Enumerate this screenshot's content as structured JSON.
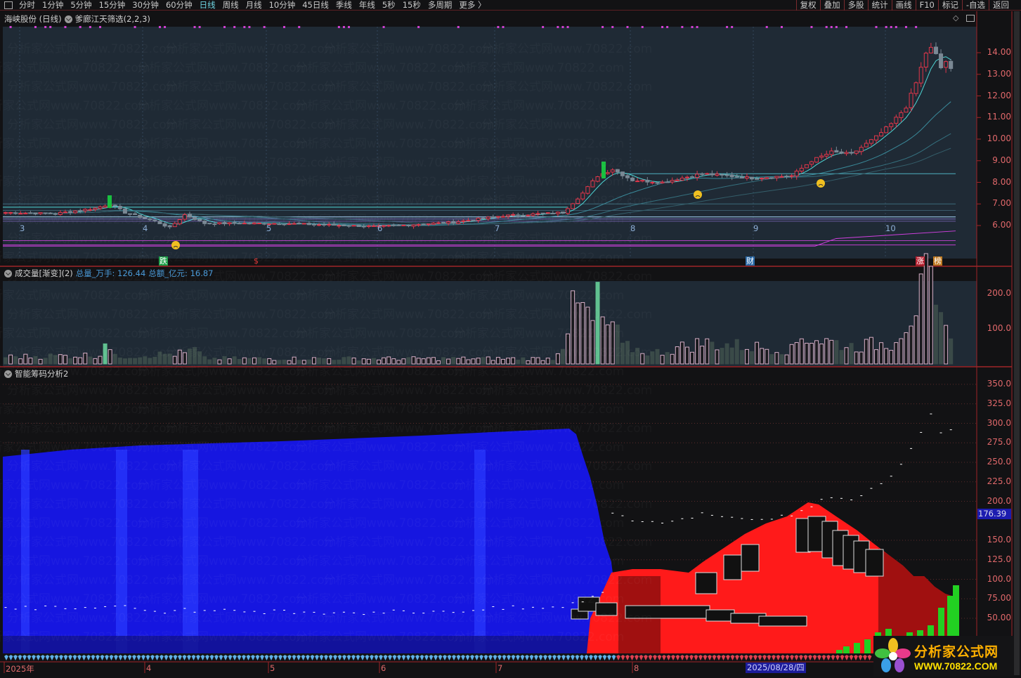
{
  "toolbar": {
    "tabs": [
      "分时",
      "1分钟",
      "5分钟",
      "15分钟",
      "30分钟",
      "60分钟",
      "日线",
      "周线",
      "月线",
      "10分钟",
      "45日线",
      "季线",
      "年线",
      "5秒",
      "15秒",
      "多周期",
      "更多 〉"
    ],
    "active_tab": "日线",
    "right_buttons": [
      "复权",
      "叠加",
      "多股",
      "统计",
      "画线",
      "F10",
      "标记",
      "-自选",
      "返回"
    ]
  },
  "price_panel": {
    "stock_title": "海峡股份 (日线)",
    "indicator": "爹廊江天筛选(2,2,3)",
    "y_ticks": [
      "14.00",
      "13.00",
      "12.00",
      "11.00",
      "10.00",
      "9.00",
      "8.00",
      "7.00",
      "6.00"
    ],
    "month_labels": [
      "3",
      "4",
      "5",
      "6",
      "7",
      "8",
      "9",
      "10"
    ],
    "event_tags": [
      {
        "text": "跌",
        "color": "#1fa04a"
      },
      {
        "text": "$",
        "color": "#e23a3a"
      },
      {
        "text": "财",
        "color": "#2a6aa8"
      },
      {
        "text": "涨",
        "color": "#b82030"
      },
      {
        "text": "榜",
        "color": "#c07a20"
      }
    ]
  },
  "volume_panel": {
    "title": "成交量[渐变](2)",
    "stat1": "总量_万手: 126.44",
    "stat2": "总额_亿元: 16.87",
    "y_ticks": [
      "200.0",
      "100.0"
    ]
  },
  "chip_panel": {
    "title": "智能筹码分析2",
    "y_ticks": [
      "350.0",
      "325.0",
      "300.0",
      "275.0",
      "250.0",
      "225.0",
      "200.0",
      "150.0",
      "125.0",
      "100.0",
      "75.00",
      "50.00"
    ],
    "current_value": "176.39"
  },
  "date_axis": {
    "labels": [
      "2025年",
      "4",
      "5",
      "6",
      "7",
      "8"
    ],
    "cursor_date": "2025/08/28/四"
  },
  "watermark": "分析家公式网www.70822.com",
  "logo": {
    "title": "分析家公式网",
    "url": "WWW.70822.COM"
  },
  "colors": {
    "up": "#e0364a",
    "down": "#7a8894",
    "ma": "#4fd6d6",
    "accent": "#6fd3e0",
    "axis": "#e0686a"
  },
  "chart_data": {
    "type": "candlestick",
    "bars": 191,
    "price_keypoints": [
      [
        0,
        6.6
      ],
      [
        10,
        6.55
      ],
      [
        18,
        6.8
      ],
      [
        21,
        7.0
      ],
      [
        24,
        6.6
      ],
      [
        30,
        6.2
      ],
      [
        33,
        5.9
      ],
      [
        36,
        6.5
      ],
      [
        40,
        6.1
      ],
      [
        55,
        6.1
      ],
      [
        75,
        5.95
      ],
      [
        90,
        6.15
      ],
      [
        100,
        6.45
      ],
      [
        112,
        6.6
      ],
      [
        116,
        7.5
      ],
      [
        119,
        8.3
      ],
      [
        122,
        8.6
      ],
      [
        126,
        8.1
      ],
      [
        132,
        8.0
      ],
      [
        140,
        8.4
      ],
      [
        150,
        8.2
      ],
      [
        158,
        8.3
      ],
      [
        162,
        9.0
      ],
      [
        166,
        9.4
      ],
      [
        170,
        9.3
      ],
      [
        175,
        10.1
      ],
      [
        178,
        10.7
      ],
      [
        181,
        11.5
      ],
      [
        183,
        12.6
      ],
      [
        185,
        14.0
      ],
      [
        186,
        14.2
      ],
      [
        187,
        13.9
      ],
      [
        188,
        13.3
      ],
      [
        189,
        13.6
      ],
      [
        190,
        13.2
      ]
    ],
    "volume_keypoints": [
      [
        0,
        20
      ],
      [
        19,
        25
      ],
      [
        20,
        80
      ],
      [
        21,
        40
      ],
      [
        22,
        20
      ],
      [
        36,
        30
      ],
      [
        38,
        40
      ],
      [
        40,
        15
      ],
      [
        110,
        15
      ],
      [
        112,
        60
      ],
      [
        114,
        150
      ],
      [
        116,
        160
      ],
      [
        118,
        110
      ],
      [
        119,
        220
      ],
      [
        120,
        100
      ],
      [
        122,
        115
      ],
      [
        124,
        50
      ],
      [
        130,
        30
      ],
      [
        140,
        60
      ],
      [
        158,
        40
      ],
      [
        160,
        80
      ],
      [
        170,
        50
      ],
      [
        178,
        60
      ],
      [
        181,
        120
      ],
      [
        184,
        190
      ],
      [
        185,
        230
      ],
      [
        186,
        200
      ],
      [
        187,
        140
      ],
      [
        188,
        110
      ],
      [
        189,
        95
      ],
      [
        190,
        115
      ]
    ],
    "price_range": [
      5.0,
      15.0
    ],
    "volume_range": [
      0,
      230
    ],
    "chip_range": [
      25,
      375
    ]
  }
}
